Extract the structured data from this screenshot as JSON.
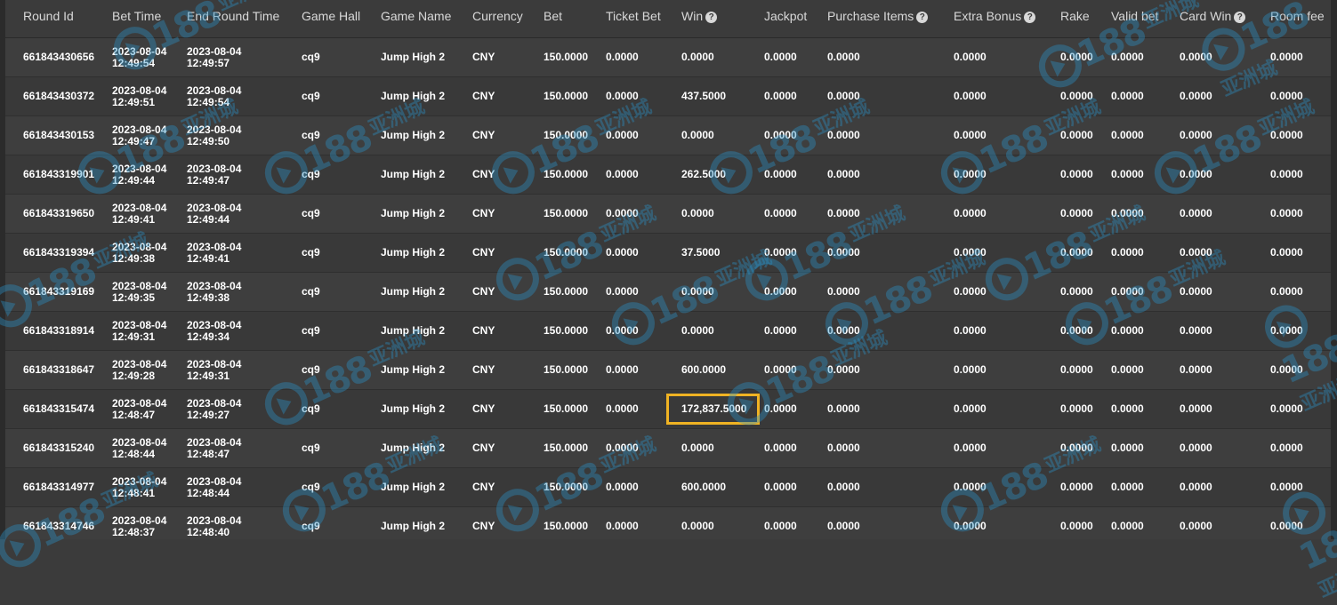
{
  "columns": [
    {
      "label": "Round Id",
      "help": false
    },
    {
      "label": "Bet Time",
      "help": false
    },
    {
      "label": "End Round Time",
      "help": false
    },
    {
      "label": "Game Hall",
      "help": false
    },
    {
      "label": "Game Name",
      "help": false
    },
    {
      "label": "Currency",
      "help": false
    },
    {
      "label": "Bet",
      "help": false
    },
    {
      "label": "Ticket Bet",
      "help": false
    },
    {
      "label": "Win",
      "help": true
    },
    {
      "label": "Jackpot",
      "help": false
    },
    {
      "label": "Purchase Items",
      "help": true
    },
    {
      "label": "Extra Bonus",
      "help": true
    },
    {
      "label": "Rake",
      "help": false
    },
    {
      "label": "Valid bet",
      "help": false
    },
    {
      "label": "Card Win",
      "help": true
    },
    {
      "label": "Room fee",
      "help": false
    }
  ],
  "help_glyph": "?",
  "highlight_color": "#f0b323",
  "highlight_row": 9,
  "rows": [
    {
      "round_id": "661843430656",
      "bet_date": "2023-08-04",
      "bet_time": "12:49:54",
      "end_date": "2023-08-04",
      "end_time": "12:49:57",
      "hall": "cq9",
      "game": "Jump High 2",
      "currency": "CNY",
      "bet": "150.0000",
      "ticket_bet": "0.0000",
      "win": "0.0000",
      "jackpot": "0.0000",
      "purchase": "0.0000",
      "extra": "0.0000",
      "rake": "0.0000",
      "valid": "0.0000",
      "card_win": "0.0000",
      "room_fee": "0.0000"
    },
    {
      "round_id": "661843430372",
      "bet_date": "2023-08-04",
      "bet_time": "12:49:51",
      "end_date": "2023-08-04",
      "end_time": "12:49:54",
      "hall": "cq9",
      "game": "Jump High 2",
      "currency": "CNY",
      "bet": "150.0000",
      "ticket_bet": "0.0000",
      "win": "437.5000",
      "jackpot": "0.0000",
      "purchase": "0.0000",
      "extra": "0.0000",
      "rake": "0.0000",
      "valid": "0.0000",
      "card_win": "0.0000",
      "room_fee": "0.0000"
    },
    {
      "round_id": "661843430153",
      "bet_date": "2023-08-04",
      "bet_time": "12:49:47",
      "end_date": "2023-08-04",
      "end_time": "12:49:50",
      "hall": "cq9",
      "game": "Jump High 2",
      "currency": "CNY",
      "bet": "150.0000",
      "ticket_bet": "0.0000",
      "win": "0.0000",
      "jackpot": "0.0000",
      "purchase": "0.0000",
      "extra": "0.0000",
      "rake": "0.0000",
      "valid": "0.0000",
      "card_win": "0.0000",
      "room_fee": "0.0000"
    },
    {
      "round_id": "661843319901",
      "bet_date": "2023-08-04",
      "bet_time": "12:49:44",
      "end_date": "2023-08-04",
      "end_time": "12:49:47",
      "hall": "cq9",
      "game": "Jump High 2",
      "currency": "CNY",
      "bet": "150.0000",
      "ticket_bet": "0.0000",
      "win": "262.5000",
      "jackpot": "0.0000",
      "purchase": "0.0000",
      "extra": "0.0000",
      "rake": "0.0000",
      "valid": "0.0000",
      "card_win": "0.0000",
      "room_fee": "0.0000"
    },
    {
      "round_id": "661843319650",
      "bet_date": "2023-08-04",
      "bet_time": "12:49:41",
      "end_date": "2023-08-04",
      "end_time": "12:49:44",
      "hall": "cq9",
      "game": "Jump High 2",
      "currency": "CNY",
      "bet": "150.0000",
      "ticket_bet": "0.0000",
      "win": "0.0000",
      "jackpot": "0.0000",
      "purchase": "0.0000",
      "extra": "0.0000",
      "rake": "0.0000",
      "valid": "0.0000",
      "card_win": "0.0000",
      "room_fee": "0.0000"
    },
    {
      "round_id": "661843319394",
      "bet_date": "2023-08-04",
      "bet_time": "12:49:38",
      "end_date": "2023-08-04",
      "end_time": "12:49:41",
      "hall": "cq9",
      "game": "Jump High 2",
      "currency": "CNY",
      "bet": "150.0000",
      "ticket_bet": "0.0000",
      "win": "37.5000",
      "jackpot": "0.0000",
      "purchase": "0.0000",
      "extra": "0.0000",
      "rake": "0.0000",
      "valid": "0.0000",
      "card_win": "0.0000",
      "room_fee": "0.0000"
    },
    {
      "round_id": "661843319169",
      "bet_date": "2023-08-04",
      "bet_time": "12:49:35",
      "end_date": "2023-08-04",
      "end_time": "12:49:38",
      "hall": "cq9",
      "game": "Jump High 2",
      "currency": "CNY",
      "bet": "150.0000",
      "ticket_bet": "0.0000",
      "win": "0.0000",
      "jackpot": "0.0000",
      "purchase": "0.0000",
      "extra": "0.0000",
      "rake": "0.0000",
      "valid": "0.0000",
      "card_win": "0.0000",
      "room_fee": "0.0000"
    },
    {
      "round_id": "661843318914",
      "bet_date": "2023-08-04",
      "bet_time": "12:49:31",
      "end_date": "2023-08-04",
      "end_time": "12:49:34",
      "hall": "cq9",
      "game": "Jump High 2",
      "currency": "CNY",
      "bet": "150.0000",
      "ticket_bet": "0.0000",
      "win": "0.0000",
      "jackpot": "0.0000",
      "purchase": "0.0000",
      "extra": "0.0000",
      "rake": "0.0000",
      "valid": "0.0000",
      "card_win": "0.0000",
      "room_fee": "0.0000"
    },
    {
      "round_id": "661843318647",
      "bet_date": "2023-08-04",
      "bet_time": "12:49:28",
      "end_date": "2023-08-04",
      "end_time": "12:49:31",
      "hall": "cq9",
      "game": "Jump High 2",
      "currency": "CNY",
      "bet": "150.0000",
      "ticket_bet": "0.0000",
      "win": "600.0000",
      "jackpot": "0.0000",
      "purchase": "0.0000",
      "extra": "0.0000",
      "rake": "0.0000",
      "valid": "0.0000",
      "card_win": "0.0000",
      "room_fee": "0.0000"
    },
    {
      "round_id": "661843315474",
      "bet_date": "2023-08-04",
      "bet_time": "12:48:47",
      "end_date": "2023-08-04",
      "end_time": "12:49:27",
      "hall": "cq9",
      "game": "Jump High 2",
      "currency": "CNY",
      "bet": "150.0000",
      "ticket_bet": "0.0000",
      "win": "172,837.5000",
      "jackpot": "0.0000",
      "purchase": "0.0000",
      "extra": "0.0000",
      "rake": "0.0000",
      "valid": "0.0000",
      "card_win": "0.0000",
      "room_fee": "0.0000"
    },
    {
      "round_id": "661843315240",
      "bet_date": "2023-08-04",
      "bet_time": "12:48:44",
      "end_date": "2023-08-04",
      "end_time": "12:48:47",
      "hall": "cq9",
      "game": "Jump High 2",
      "currency": "CNY",
      "bet": "150.0000",
      "ticket_bet": "0.0000",
      "win": "0.0000",
      "jackpot": "0.0000",
      "purchase": "0.0000",
      "extra": "0.0000",
      "rake": "0.0000",
      "valid": "0.0000",
      "card_win": "0.0000",
      "room_fee": "0.0000"
    },
    {
      "round_id": "661843314977",
      "bet_date": "2023-08-04",
      "bet_time": "12:48:41",
      "end_date": "2023-08-04",
      "end_time": "12:48:44",
      "hall": "cq9",
      "game": "Jump High 2",
      "currency": "CNY",
      "bet": "150.0000",
      "ticket_bet": "0.0000",
      "win": "600.0000",
      "jackpot": "0.0000",
      "purchase": "0.0000",
      "extra": "0.0000",
      "rake": "0.0000",
      "valid": "0.0000",
      "card_win": "0.0000",
      "room_fee": "0.0000"
    },
    {
      "round_id": "661843314746",
      "bet_date": "2023-08-04",
      "bet_time": "12:48:37",
      "end_date": "2023-08-04",
      "end_time": "12:48:40",
      "hall": "cq9",
      "game": "Jump High 2",
      "currency": "CNY",
      "bet": "150.0000",
      "ticket_bet": "0.0000",
      "win": "0.0000",
      "jackpot": "0.0000",
      "purchase": "0.0000",
      "extra": "0.0000",
      "rake": "0.0000",
      "valid": "0.0000",
      "card_win": "0.0000",
      "room_fee": "0.0000"
    }
  ],
  "watermark": {
    "text": "188",
    "cn": "亚洲城",
    "icon": "c-play-logo-icon"
  }
}
